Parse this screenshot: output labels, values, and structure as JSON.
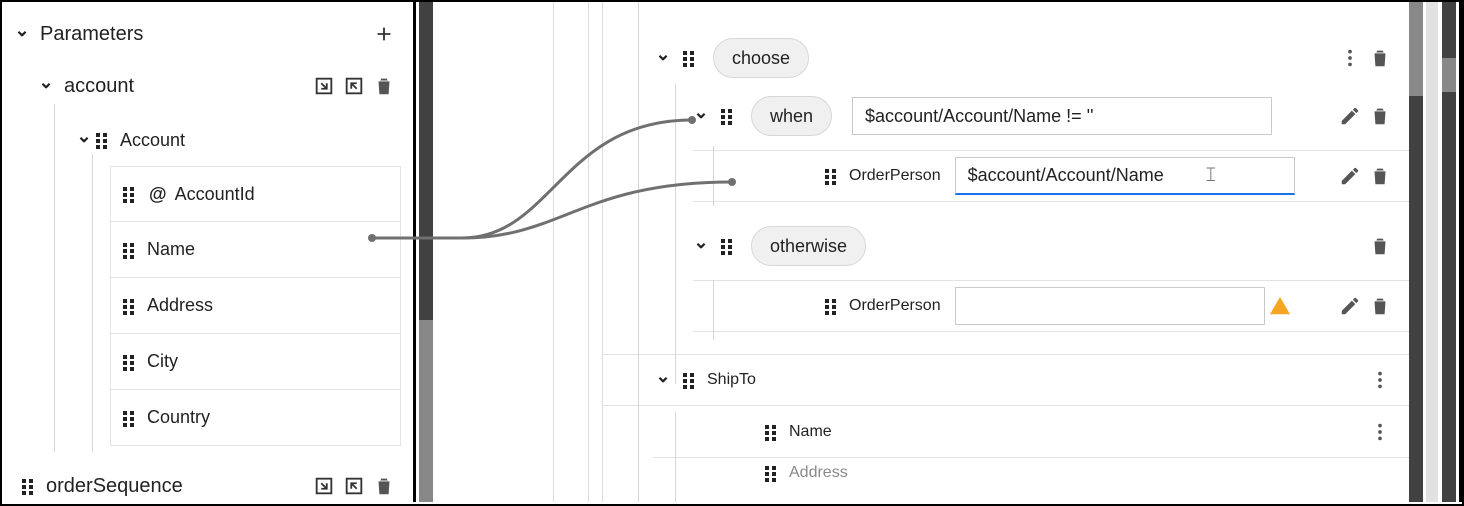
{
  "left": {
    "parametersTitle": "Parameters",
    "account": {
      "name": "account",
      "type": "Account",
      "fields": [
        "AccountId",
        "Name",
        "Address",
        "City",
        "Country"
      ]
    },
    "orderSequence": "orderSequence"
  },
  "right": {
    "choose": "choose",
    "when": {
      "label": "when",
      "expr": "$account/Account/Name != ''"
    },
    "whenChild": {
      "label": "OrderPerson",
      "value": "$account/Account/Name"
    },
    "otherwise": {
      "label": "otherwise"
    },
    "otherwiseChild": {
      "label": "OrderPerson",
      "value": ""
    },
    "shipTo": "ShipTo",
    "shipToFields": [
      "Name",
      "Address"
    ]
  }
}
